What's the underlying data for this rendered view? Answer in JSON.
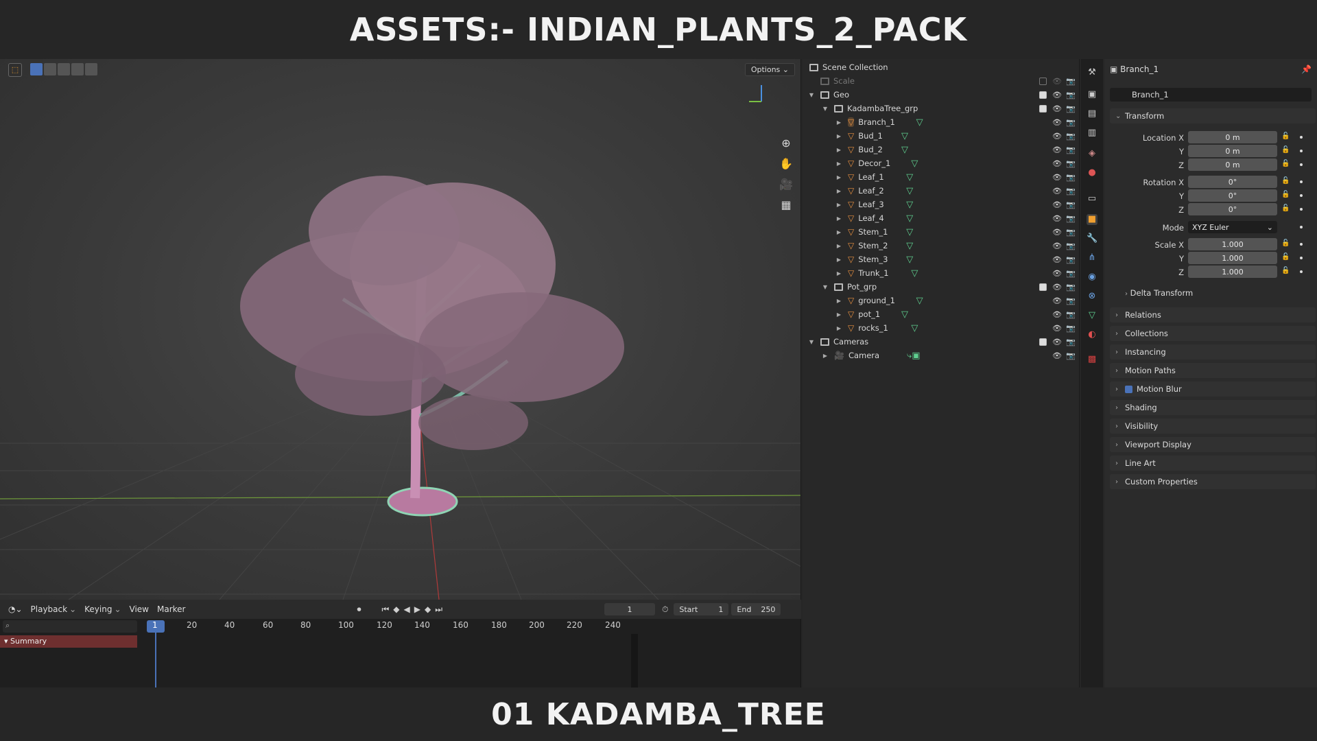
{
  "banner": {
    "top_title": "ASSETS:- INDIAN_PLANTS_2_PACK",
    "bottom_title": "01  KADAMBA_TREE"
  },
  "viewport": {
    "options_label": "Options"
  },
  "timeline": {
    "menus": [
      "Playback",
      "Keying",
      "View",
      "Marker"
    ],
    "current_frame": "1",
    "start_label": "Start",
    "start": "1",
    "end_label": "End",
    "end": "250",
    "ruler": [
      "1",
      "20",
      "40",
      "60",
      "80",
      "100",
      "120",
      "140",
      "160",
      "180",
      "200",
      "220",
      "240"
    ],
    "summary_label": "Summary"
  },
  "outliner": {
    "scene_collection": "Scene Collection",
    "rows": [
      {
        "label": "Scale",
        "type": "collection",
        "depth": 1,
        "dim": true,
        "check": false
      },
      {
        "label": "Geo",
        "type": "collection",
        "depth": 1,
        "check": true,
        "open": true
      },
      {
        "label": "KadambaTree_grp",
        "type": "collection",
        "depth": 2,
        "check": true,
        "open": true
      },
      {
        "label": "Branch_1",
        "type": "object",
        "depth": 3,
        "selected": true
      },
      {
        "label": "Bud_1",
        "type": "object",
        "depth": 3
      },
      {
        "label": "Bud_2",
        "type": "object",
        "depth": 3
      },
      {
        "label": "Decor_1",
        "type": "object",
        "depth": 3
      },
      {
        "label": "Leaf_1",
        "type": "object",
        "depth": 3
      },
      {
        "label": "Leaf_2",
        "type": "object",
        "depth": 3
      },
      {
        "label": "Leaf_3",
        "type": "object",
        "depth": 3
      },
      {
        "label": "Leaf_4",
        "type": "object",
        "depth": 3
      },
      {
        "label": "Stem_1",
        "type": "object",
        "depth": 3
      },
      {
        "label": "Stem_2",
        "type": "object",
        "depth": 3
      },
      {
        "label": "Stem_3",
        "type": "object",
        "depth": 3
      },
      {
        "label": "Trunk_1",
        "type": "object",
        "depth": 3
      },
      {
        "label": "Pot_grp",
        "type": "collection",
        "depth": 2,
        "check": true,
        "open": true
      },
      {
        "label": "ground_1",
        "type": "object",
        "depth": 3
      },
      {
        "label": "pot_1",
        "type": "object",
        "depth": 3
      },
      {
        "label": "rocks_1",
        "type": "object",
        "depth": 3
      },
      {
        "label": "Cameras",
        "type": "collection",
        "depth": 1,
        "check": true,
        "open": true
      },
      {
        "label": "Camera",
        "type": "camera",
        "depth": 2
      }
    ]
  },
  "properties": {
    "header_name": "Branch_1",
    "object_name": "Branch_1",
    "transform_label": "Transform",
    "location_label": "Location X",
    "location": [
      "0 m",
      "0 m",
      "0 m"
    ],
    "rotation_label": "Rotation X",
    "rotation": [
      "0°",
      "0°",
      "0°"
    ],
    "mode_label": "Mode",
    "mode": "XYZ Euler",
    "scale_label": "Scale X",
    "scale": [
      "1.000",
      "1.000",
      "1.000"
    ],
    "axis_y": "Y",
    "axis_z": "Z",
    "delta_transform": "Delta Transform",
    "sections": [
      "Relations",
      "Collections",
      "Instancing",
      "Motion Paths",
      "Motion Blur",
      "Shading",
      "Visibility",
      "Viewport Display",
      "Line Art",
      "Custom Properties"
    ]
  }
}
